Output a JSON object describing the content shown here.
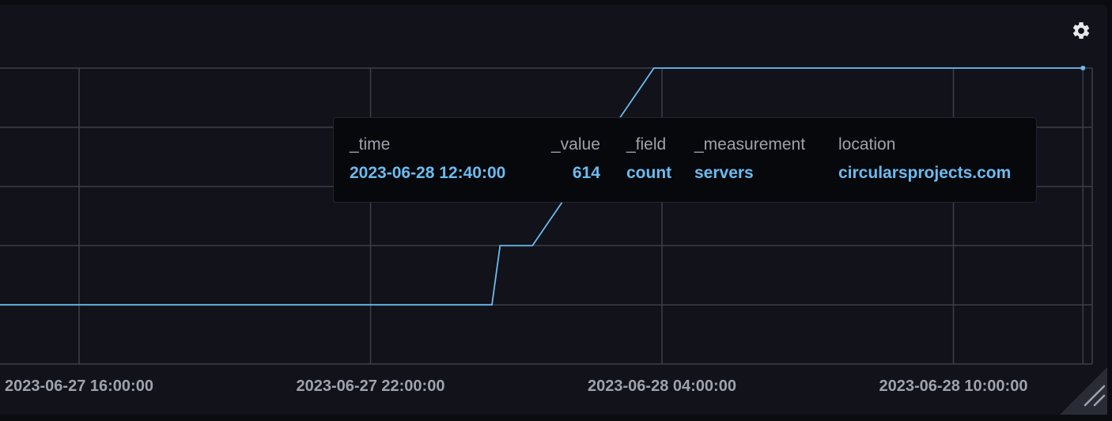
{
  "settings_icon": "gear-icon",
  "resize_icon": "resize-handle-icon",
  "colors": {
    "background": "#11121a",
    "grid": "#3c3f4a",
    "line": "#6cbbef",
    "tick_text": "#9ea2ad",
    "tooltip_value": "#6cbbef"
  },
  "chart_data": {
    "type": "line",
    "title": "",
    "xlabel": "",
    "ylabel": "",
    "grid": true,
    "legend": "none",
    "x_ticks": [
      "2023-06-27 16:00:00",
      "2023-06-27 22:00:00",
      "2023-06-28 04:00:00",
      "2023-06-28 10:00:00"
    ],
    "series": [
      {
        "points": [
          {
            "x": "2023-06-27 09:30:00",
            "y": 4
          },
          {
            "x": "2023-06-28 00:30:00",
            "y": 4
          },
          {
            "x": "2023-06-28 00:40:00",
            "y": 5
          },
          {
            "x": "2023-06-28 01:20:00",
            "y": 5
          },
          {
            "x": "2023-06-28 03:50:00",
            "y": 8
          },
          {
            "x": "2023-06-28 04:00:00",
            "y": 8
          },
          {
            "x": "2023-06-28 12:40:00",
            "y": 8
          }
        ]
      }
    ],
    "highlight": {
      "x": "2023-06-28 12:40:00"
    }
  },
  "tooltip": {
    "columns": [
      {
        "header": "_time",
        "value": "2023-06-28 12:40:00"
      },
      {
        "header": "_value",
        "value": "614"
      },
      {
        "header": "_field",
        "value": "count"
      },
      {
        "header": "_measurement",
        "value": "servers"
      },
      {
        "header": "location",
        "value": "circularsprojects.com"
      }
    ]
  }
}
